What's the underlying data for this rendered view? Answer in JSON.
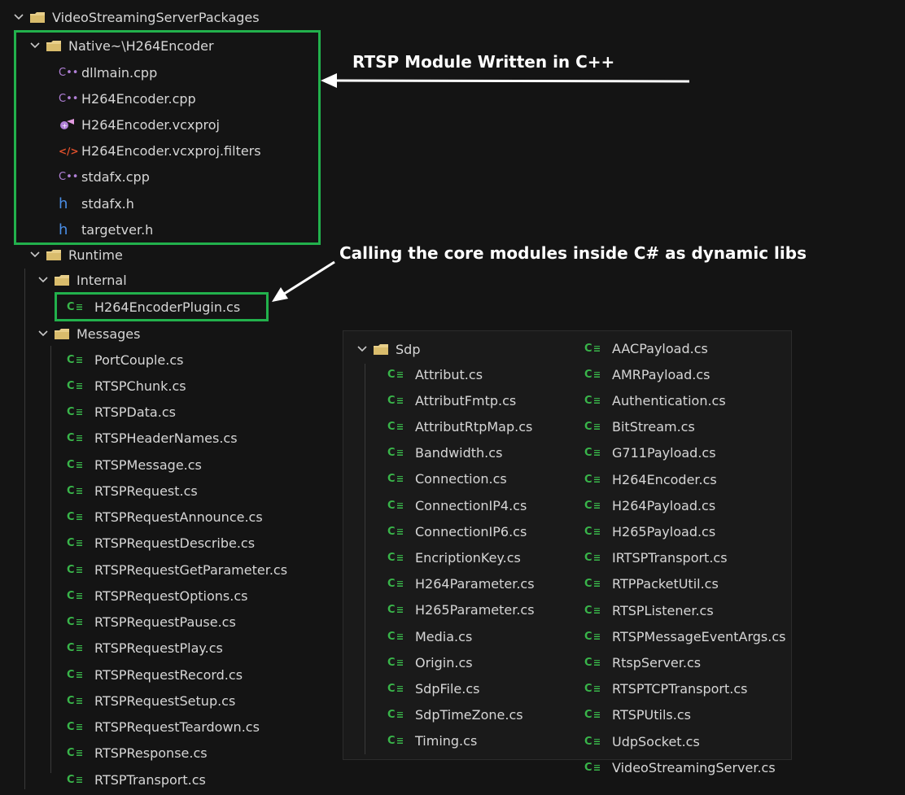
{
  "colors": {
    "background": "#141414",
    "highlight": "#22b14c",
    "cs_icon": "#39b54a",
    "folder": "#e8cf8a",
    "annotation": "#ffffff"
  },
  "tree": {
    "root": "VideoStreamingServerPackages",
    "native_folder": "Native~\\H264Encoder",
    "native_files": [
      {
        "name": "dllmain.cpp",
        "icon": "cpp-icon"
      },
      {
        "name": "H264Encoder.cpp",
        "icon": "cpp-icon"
      },
      {
        "name": "H264Encoder.vcxproj",
        "icon": "vcxproj-icon"
      },
      {
        "name": "H264Encoder.vcxproj.filters",
        "icon": "xml-filters-icon"
      },
      {
        "name": "stdafx.cpp",
        "icon": "cpp-icon"
      },
      {
        "name": "stdafx.h",
        "icon": "header-icon"
      },
      {
        "name": "targetver.h",
        "icon": "header-icon"
      }
    ],
    "runtime_folder": "Runtime",
    "internal_folder": "Internal",
    "internal_files": [
      "H264EncoderPlugin.cs"
    ],
    "messages_folder": "Messages",
    "messages_files": [
      "PortCouple.cs",
      "RTSPChunk.cs",
      "RTSPData.cs",
      "RTSPHeaderNames.cs",
      "RTSPMessage.cs",
      "RTSPRequest.cs",
      "RTSPRequestAnnounce.cs",
      "RTSPRequestDescribe.cs",
      "RTSPRequestGetParameter.cs",
      "RTSPRequestOptions.cs",
      "RTSPRequestPause.cs",
      "RTSPRequestPlay.cs",
      "RTSPRequestRecord.cs",
      "RTSPRequestSetup.cs",
      "RTSPRequestTeardown.cs",
      "RTSPResponse.cs",
      "RTSPTransport.cs"
    ],
    "sdp_folder": "Sdp",
    "sdp_files": [
      "Attribut.cs",
      "AttributFmtp.cs",
      "AttributRtpMap.cs",
      "Bandwidth.cs",
      "Connection.cs",
      "ConnectionIP4.cs",
      "ConnectionIP6.cs",
      "EncriptionKey.cs",
      "H264Parameter.cs",
      "H265Parameter.cs",
      "Media.cs",
      "Origin.cs",
      "SdpFile.cs",
      "SdpTimeZone.cs",
      "Timing.cs"
    ],
    "other_files": [
      "AACPayload.cs",
      "AMRPayload.cs",
      "Authentication.cs",
      "BitStream.cs",
      "G711Payload.cs",
      "H264Encoder.cs",
      "H264Payload.cs",
      "H265Payload.cs",
      "IRTSPTransport.cs",
      "RTPPacketUtil.cs",
      "RTSPListener.cs",
      "RTSPMessageEventArgs.cs",
      "RtspServer.cs",
      "RTSPTCPTransport.cs",
      "RTSPUtils.cs",
      "UdpSocket.cs",
      "VideoStreamingServer.cs"
    ]
  },
  "annotations": {
    "rtsp_module": "RTSP Module Written in C++",
    "calling_core": "Calling the core modules inside C# as dynamic libs"
  }
}
